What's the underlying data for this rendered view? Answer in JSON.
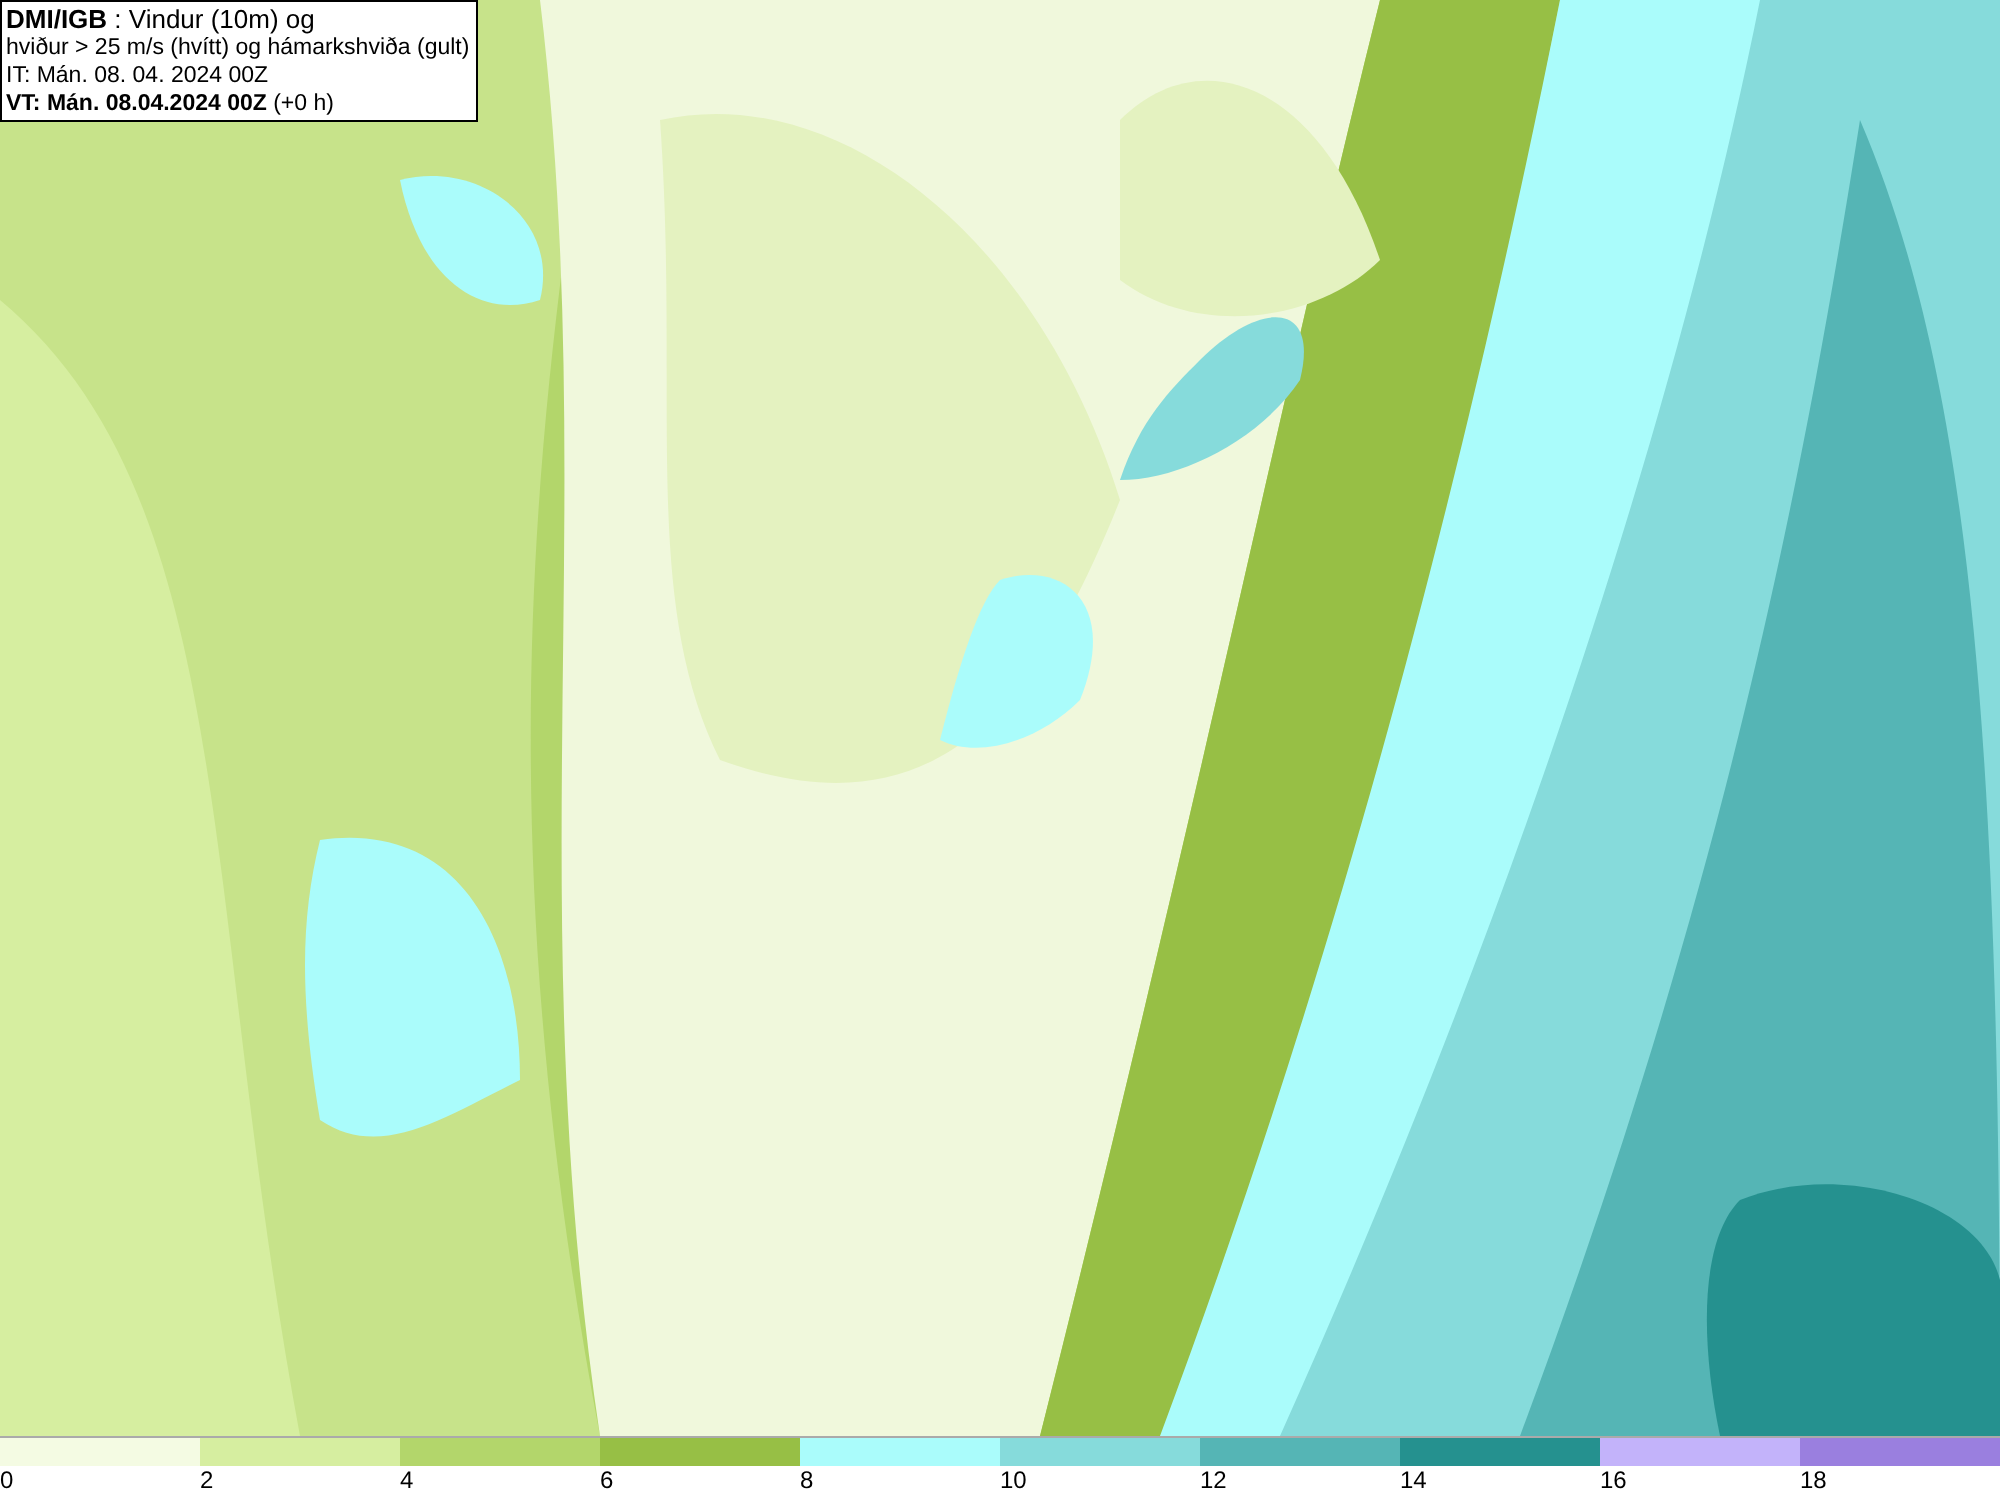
{
  "title_box": {
    "lines": [
      "**DMI/IGB** : Vindur (10m) og",
      "hviður > 25 m/s (hvítt) og hámarkshviða (gult)",
      "IT: Mán. 08. 04. 2024 00Z",
      "**VT: Mán. 08.04.2024 00Z** (+0 h)"
    ]
  },
  "legend": {
    "segments": [
      {
        "label": "0",
        "color": "#f4fbe3"
      },
      {
        "label": "2",
        "color": "#d6eea0"
      },
      {
        "label": "4",
        "color": "#b3d66b"
      },
      {
        "label": "6",
        "color": "#97bf45"
      },
      {
        "label": "8",
        "color": "#aafcfb"
      },
      {
        "label": "10",
        "color": "#86dbdb"
      },
      {
        "label": "12",
        "color": "#55b5b5"
      },
      {
        "label": "14",
        "color": "#25918f"
      },
      {
        "label": "16",
        "color": "#c3b3fa"
      },
      {
        "label": "18",
        "color": "#9a7fdf"
      }
    ]
  }
}
